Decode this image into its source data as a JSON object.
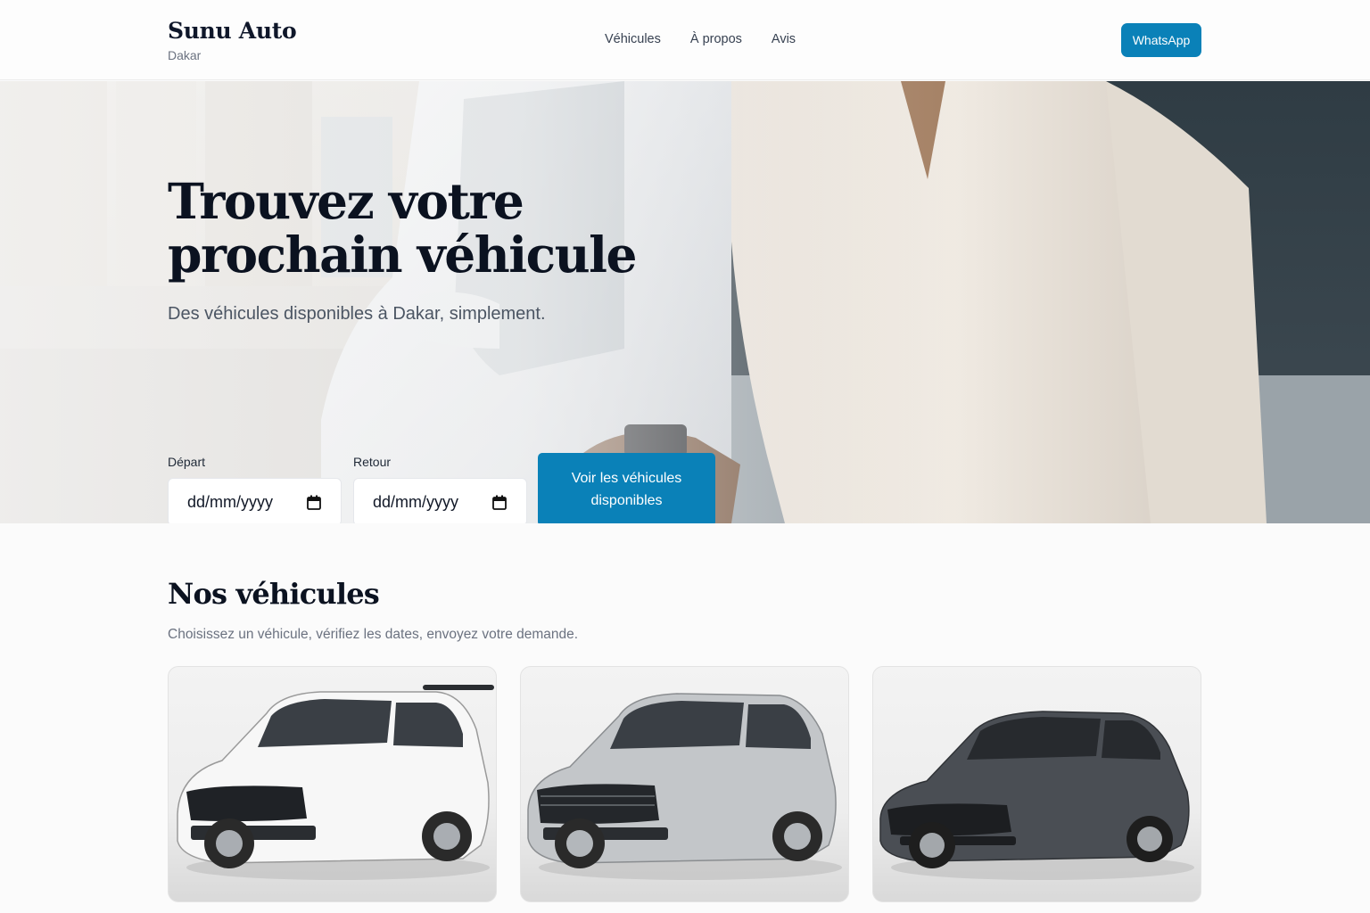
{
  "header": {
    "brand": "Sunu Auto",
    "city": "Dakar",
    "nav": [
      {
        "label": "Véhicules"
      },
      {
        "label": "À propos"
      },
      {
        "label": "Avis"
      }
    ],
    "whatsapp_label": "WhatsApp"
  },
  "hero": {
    "title": "Trouvez votre prochain véhicule",
    "subtitle": "Des véhicules disponibles à Dakar, simplement.",
    "departure": {
      "label": "Départ",
      "placeholder": "dd/mm/yyyy"
    },
    "return": {
      "label": "Retour",
      "placeholder": "dd/mm/yyyy"
    },
    "cta_label": "Voir les véhicules disponibles"
  },
  "vehicles": {
    "title": "Nos véhicules",
    "subtitle": "Choisissez un véhicule, vérifiez les dates, envoyez votre demande.",
    "cards": [
      {
        "color": "#f7f7f7"
      },
      {
        "color": "#bfc2c5"
      },
      {
        "color": "#4a4e54"
      }
    ]
  },
  "colors": {
    "accent": "#0a81b8",
    "heading": "#0b1220",
    "muted": "#6b7280"
  }
}
